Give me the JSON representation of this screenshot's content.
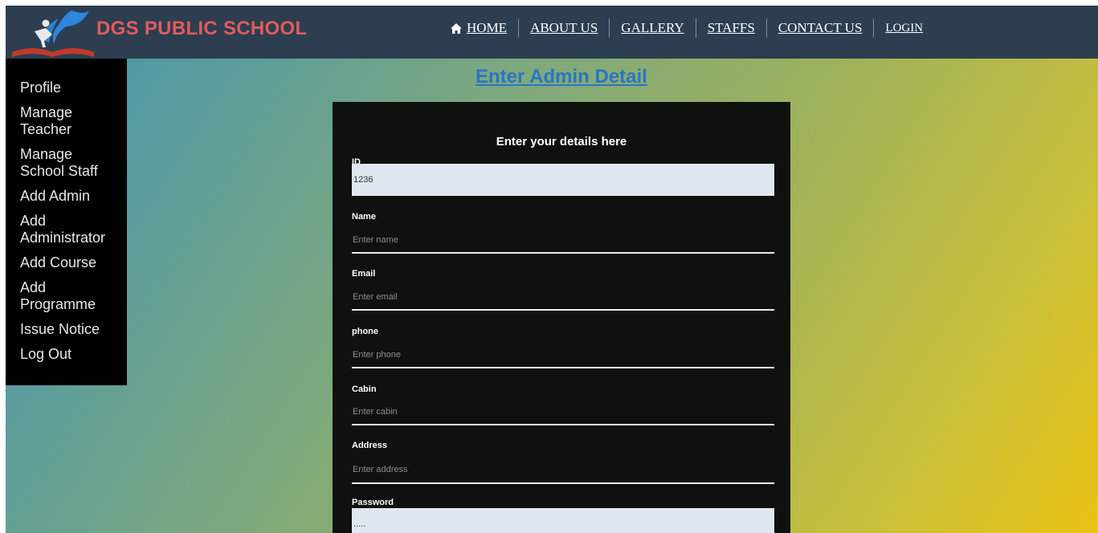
{
  "brand": {
    "name": "DGS PUBLIC SCHOOL",
    "logo_icon": "running-figure-book-logo-icon"
  },
  "nav": {
    "items": [
      {
        "label": "HOME",
        "icon": "home-icon"
      },
      {
        "label": "ABOUT US"
      },
      {
        "label": "GALLERY"
      },
      {
        "label": "STAFFS"
      },
      {
        "label": "CONTACT US"
      },
      {
        "label": "LOGIN"
      }
    ]
  },
  "sidebar": {
    "items": [
      {
        "label": "Profile"
      },
      {
        "label": "Manage\nTeacher"
      },
      {
        "label": "Manage\nSchool Staff"
      },
      {
        "label": "Add Admin"
      },
      {
        "label": "Add\nAdministrator"
      },
      {
        "label": "Add Course"
      },
      {
        "label": "Add\nProgramme"
      },
      {
        "label": "Issue Notice"
      },
      {
        "label": "Log Out"
      }
    ]
  },
  "page": {
    "title": "Enter Admin Detail"
  },
  "form": {
    "heading": "Enter your details here",
    "fields": {
      "id": {
        "label": "ID",
        "value": "1236"
      },
      "name": {
        "label": "Name",
        "placeholder": "Enter name"
      },
      "email": {
        "label": "Email",
        "placeholder": "Enter email"
      },
      "phone": {
        "label": "phone",
        "placeholder": "Enter phone"
      },
      "cabin": {
        "label": "Cabin",
        "placeholder": "Enter cabin"
      },
      "address": {
        "label": "Address",
        "placeholder": "Enter address"
      },
      "password": {
        "label": "Password",
        "value": "....."
      }
    }
  },
  "colors": {
    "navbar": "#2c3e50",
    "brand": "#e15b5b",
    "title": "#2a76c5",
    "panel": "#0f110e",
    "sidebar": "#000000"
  }
}
